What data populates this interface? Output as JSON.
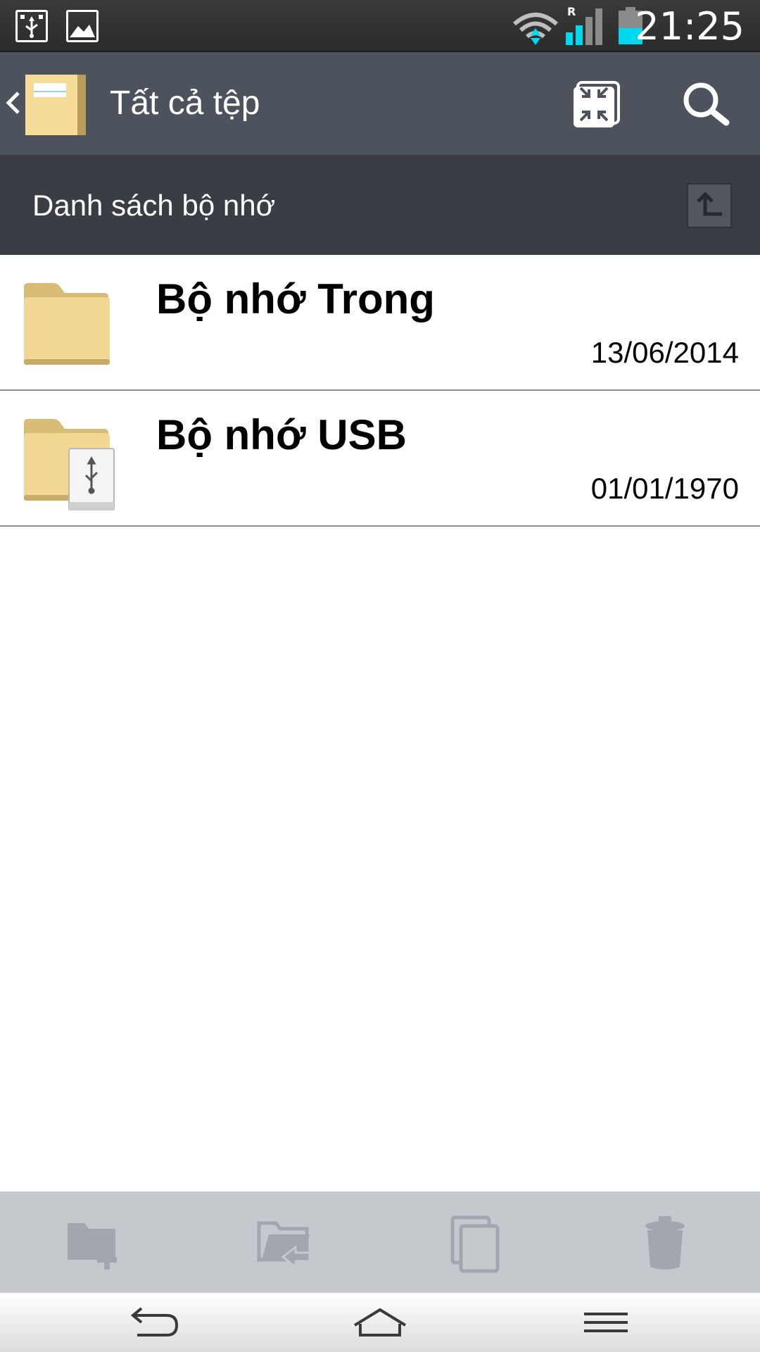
{
  "status_bar": {
    "time": "21:25",
    "roaming_indicator": "R",
    "icons": [
      "usb-connected-icon",
      "gallery-icon",
      "wifi-icon",
      "signal-icon",
      "battery-icon"
    ],
    "accent_color": "#00d8f0"
  },
  "action_bar": {
    "title": "Tất cả tệp",
    "icons": [
      "back-chevron-icon",
      "file-manager-app-icon",
      "collapse-view-icon",
      "search-icon"
    ]
  },
  "sub_header": {
    "label": "Danh sách bộ nhớ",
    "icons": [
      "up-folder-icon"
    ]
  },
  "storage_list": [
    {
      "name": "Bộ nhớ Trong",
      "date": "13/06/2014",
      "icon": "folder-icon"
    },
    {
      "name": "Bộ nhớ USB",
      "date": "01/01/1970",
      "icon": "usb-folder-icon"
    }
  ],
  "toolbar": {
    "icons": [
      "new-folder-icon",
      "move-icon",
      "copy-icon",
      "delete-icon"
    ]
  },
  "nav_bar": {
    "icons": [
      "back-icon",
      "home-icon",
      "menu-icon"
    ]
  },
  "colors": {
    "action_bar_bg": "#4c535d",
    "sub_header_bg": "#393d44",
    "toolbar_bg": "#c5c8cd",
    "folder_color": "#f1d58f"
  }
}
